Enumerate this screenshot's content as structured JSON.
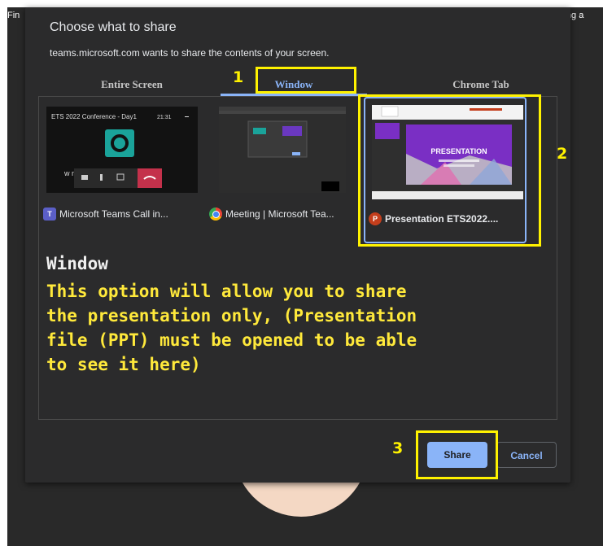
{
  "background": {
    "left_text": "Fin",
    "right_text": "ying a"
  },
  "dialog": {
    "title": "Choose what to share",
    "subtitle": "teams.microsoft.com wants to share the contents of your screen.",
    "tabs": [
      {
        "label": "Entire Screen",
        "active": false
      },
      {
        "label": "Window",
        "active": true
      },
      {
        "label": "Chrome Tab",
        "active": false
      }
    ],
    "windows": [
      {
        "label": "Microsoft Teams Call in...",
        "app_icon": "teams-icon",
        "preview": {
          "title": "ETS 2022 Conference - Day1",
          "time": "21:31",
          "caption": "w        m"
        }
      },
      {
        "label": "Meeting | Microsoft Tea...",
        "app_icon": "chrome-icon"
      },
      {
        "label": "Presentation ETS2022....",
        "app_icon": "powerpoint-icon",
        "selected": true,
        "preview": {
          "slide_title": "PRESENTATION"
        }
      }
    ],
    "share_label": "Share",
    "cancel_label": "Cancel"
  },
  "annotation": {
    "markers": [
      "1",
      "2",
      "3"
    ],
    "title": "Window",
    "body": "This option will allow you to share\nthe presentation only, (Presentation\nfile (PPT) must be opened to be able\nto see it here)"
  },
  "colors": {
    "highlight": "#fff200",
    "accent": "#8ab4f8",
    "dialog_bg": "#2b2b2c"
  }
}
